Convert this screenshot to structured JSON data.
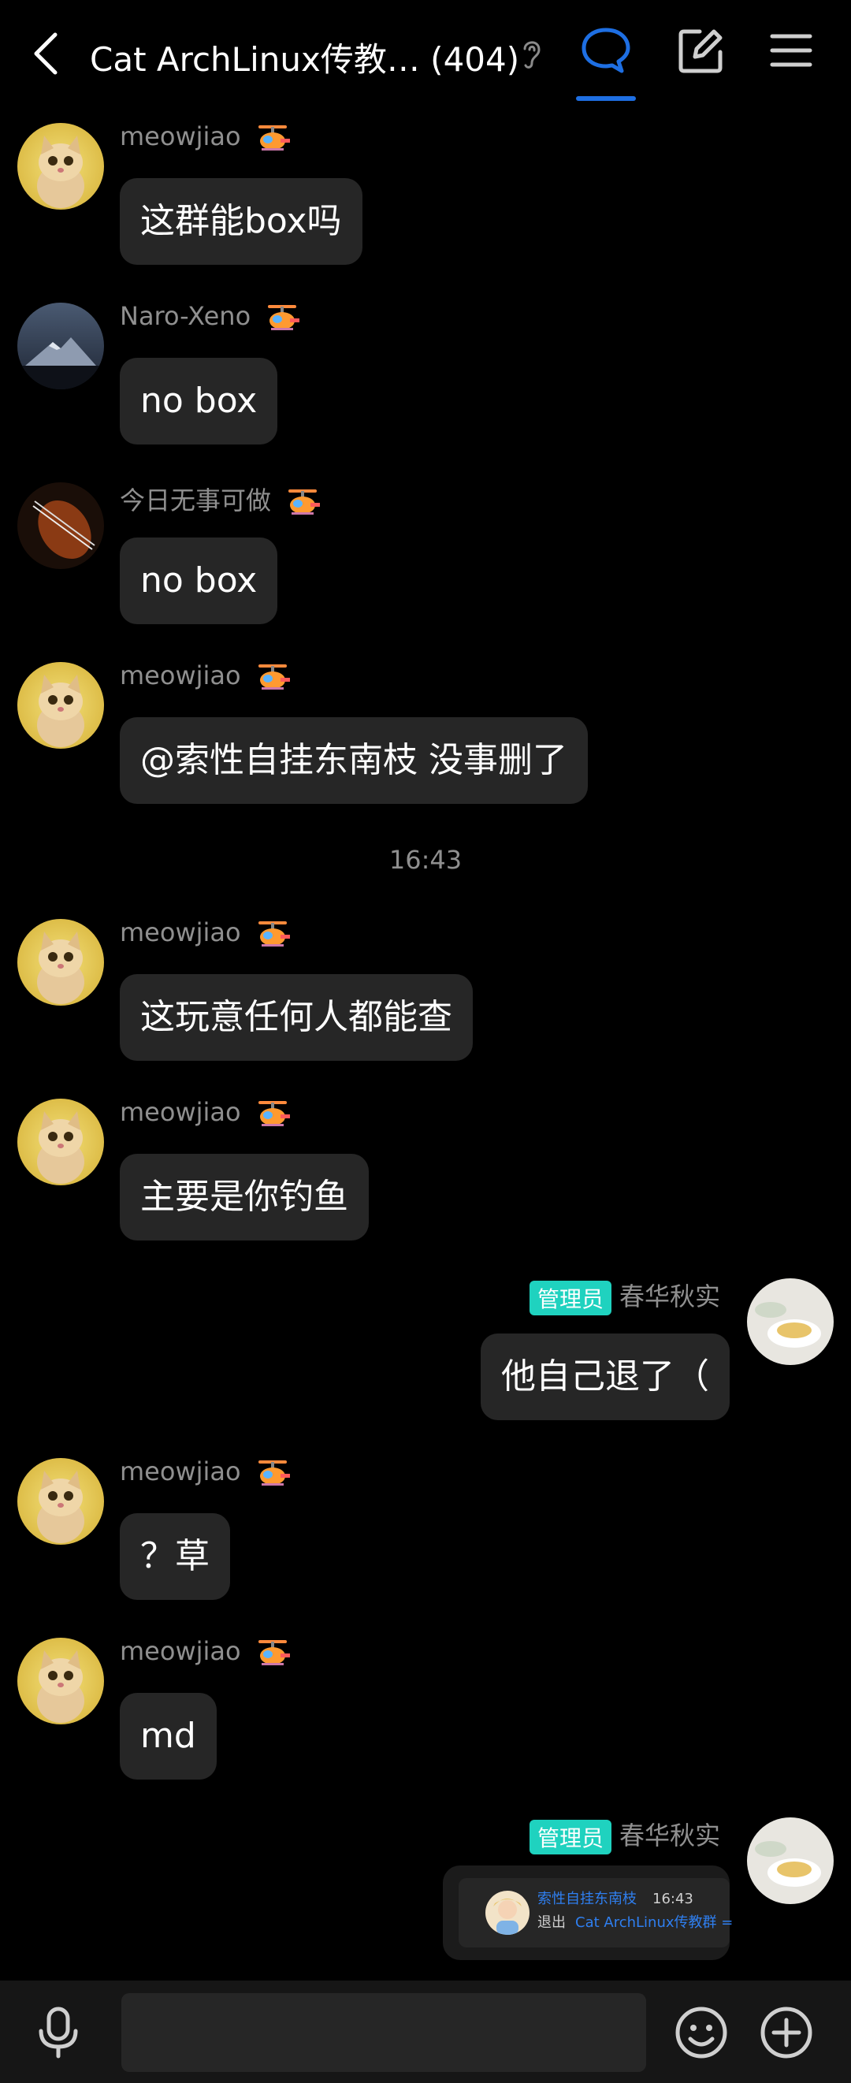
{
  "header": {
    "title": "Cat ArchLinux传教… (404)",
    "icons": [
      "back-arrow-icon",
      "ear-icon",
      "chat-bubble-icon",
      "edit-icon",
      "menu-icon"
    ]
  },
  "messages": [
    {
      "sender": "meowjiao",
      "text": "这群能box吗"
    },
    {
      "sender": "Naro-Xeno",
      "text": "no box"
    },
    {
      "sender": "今日无事可做",
      "text": "no box"
    },
    {
      "sender": "meowjiao",
      "text": "@索性自挂东南枝 没事删了"
    },
    {
      "time": "16:43"
    },
    {
      "sender": "meowjiao",
      "text": "这玩意任何人都能查"
    },
    {
      "sender": "meowjiao",
      "text": "主要是你钓鱼"
    },
    {
      "sender": "春华秋实",
      "badge": "管理员",
      "text": "他自己退了（"
    },
    {
      "sender": "meowjiao",
      "text": "？草"
    },
    {
      "sender": "meowjiao",
      "text": "md"
    },
    {
      "sender": "春华秋实",
      "badge": "管理员"
    }
  ],
  "notice": {
    "name": "索性自挂东南枝",
    "time": "16:43",
    "action": "退出",
    "group": "Cat ArchLinux传教群 ="
  },
  "input": {
    "placeholder": ""
  },
  "colors": {
    "accent": "#1e6fe3",
    "admin_badge": "#1fd2bf",
    "bubble": "#262626"
  }
}
